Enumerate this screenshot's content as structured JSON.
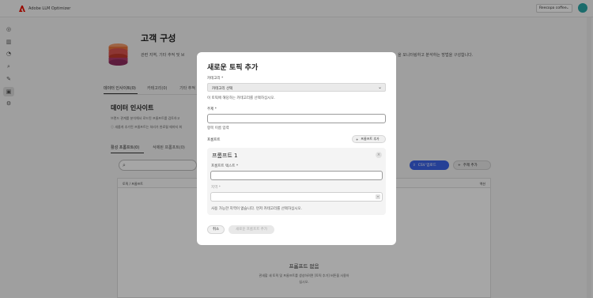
{
  "app": {
    "title": "Adobe LLM Optimizer",
    "org": "Reecopa coffee"
  },
  "colors": {
    "accent": "#3b63e6",
    "brand": "#eb1000"
  },
  "rail": [
    {
      "icon": "dashboard-icon"
    },
    {
      "icon": "chart-icon"
    },
    {
      "icon": "history-icon"
    },
    {
      "icon": "search-icon"
    },
    {
      "icon": "tools-icon"
    },
    {
      "icon": "customer-config-icon",
      "active": true
    },
    {
      "icon": "settings-icon"
    }
  ],
  "page": {
    "title": "고객 구성",
    "subtitle": "관련 지역, 기타 추적 및 브",
    "subtitle_right": "을 모니터링하고 분석하는 방법을 구성합니다.",
    "tabs": [
      "데이터 인사이트(0)",
      "카테고리(0)",
      "기타 추적"
    ],
    "section_title": "데이터 인사이트",
    "section_desc": "브랜드 관계를 분석해서 로드된 프롬프트를 검토하고",
    "section_note": "새롭게 추가된 프롬프트는 처리가 완료될 때까지 최",
    "prompt_tabs": [
      "활성 프롬프트(0)",
      "삭제된 프롬프트(0)"
    ],
    "csv_upload": "CSV 업로드",
    "add_topic": "주제 추가",
    "table_headers": {
      "topic": "토픽 / 프롬프트",
      "action": "액션"
    },
    "empty_title": "프롬프트 없음",
    "empty_desc_1": "관새할 새 토픽 및 프롬프트를 생성하려면 [토픽 추가] 버튼을 사용하",
    "empty_desc_2": "십시오."
  },
  "modal": {
    "title": "새로운 토픽 추가",
    "category_label": "카테고리 *",
    "category_value": "카테고리 선택",
    "category_help": "이 토픽에 해당하는 카테고리를 선택하십시오.",
    "topic_label": "주제 *",
    "topic_help": "항목 이름 입력",
    "prompts_label": "프롬프트",
    "add_prompt": "프롬프트 추가",
    "prompt_card_title": "프롬프트 1",
    "prompt_text_label": "프롬프트 텍스트 *",
    "region_label": "지역 *",
    "region_help": "사용 가능한 지역이 없습니다. 먼저 카테고리를 선택하십시오.",
    "cancel": "취소",
    "submit": "새로운 프롬프트 추가"
  }
}
